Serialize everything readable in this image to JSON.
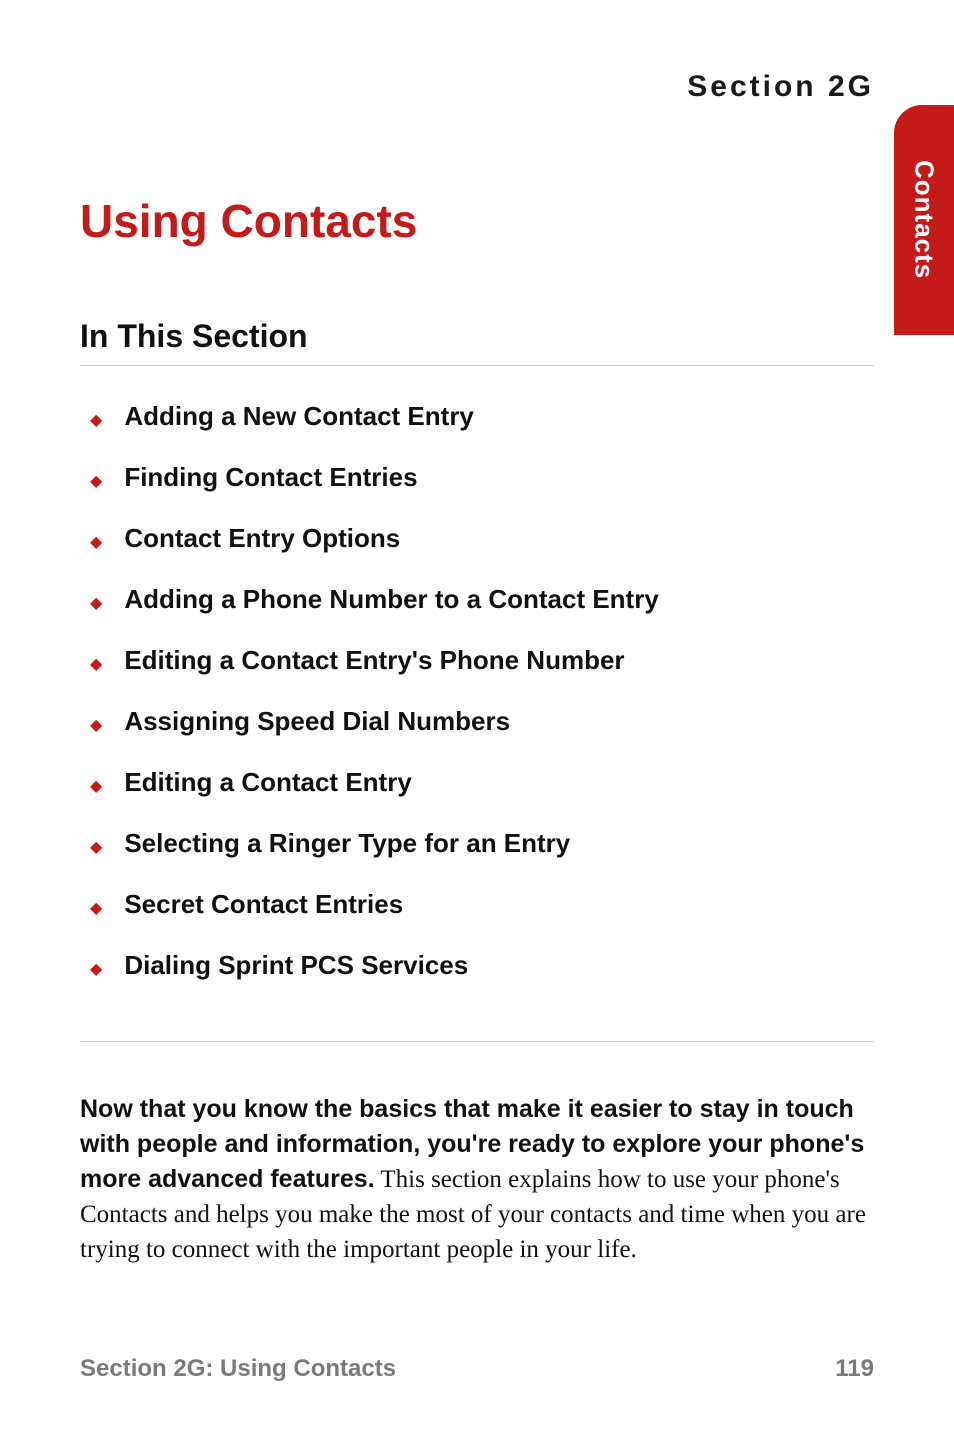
{
  "header": {
    "section_label": "Section 2G"
  },
  "thumb_tab": {
    "text": "Contacts"
  },
  "title": "Using Contacts",
  "subhead": "In This Section",
  "toc": [
    {
      "label": "Adding a New Contact Entry"
    },
    {
      "label": "Finding Contact Entries"
    },
    {
      "label": "Contact Entry Options"
    },
    {
      "label": "Adding a Phone Number to a Contact Entry"
    },
    {
      "label": "Editing a Contact Entry's Phone Number"
    },
    {
      "label": "Assigning Speed Dial Numbers"
    },
    {
      "label": "Editing a Contact Entry"
    },
    {
      "label": "Selecting a Ringer Type for an  Entry"
    },
    {
      "label": "Secret Contact Entries"
    },
    {
      "label": "Dialing Sprint PCS Services"
    }
  ],
  "body": {
    "lead": "Now that you know the basics that make it easier to stay in touch with people and information, you're ready to explore your phone's more advanced features.",
    "rest": " This section explains how to use your phone's Contacts and helps you make the most of your contacts and time when you are trying to connect with the important people in your life."
  },
  "footer": {
    "left": "Section 2G: Using Contacts",
    "right": "119"
  },
  "bullet_glyph": "◆"
}
